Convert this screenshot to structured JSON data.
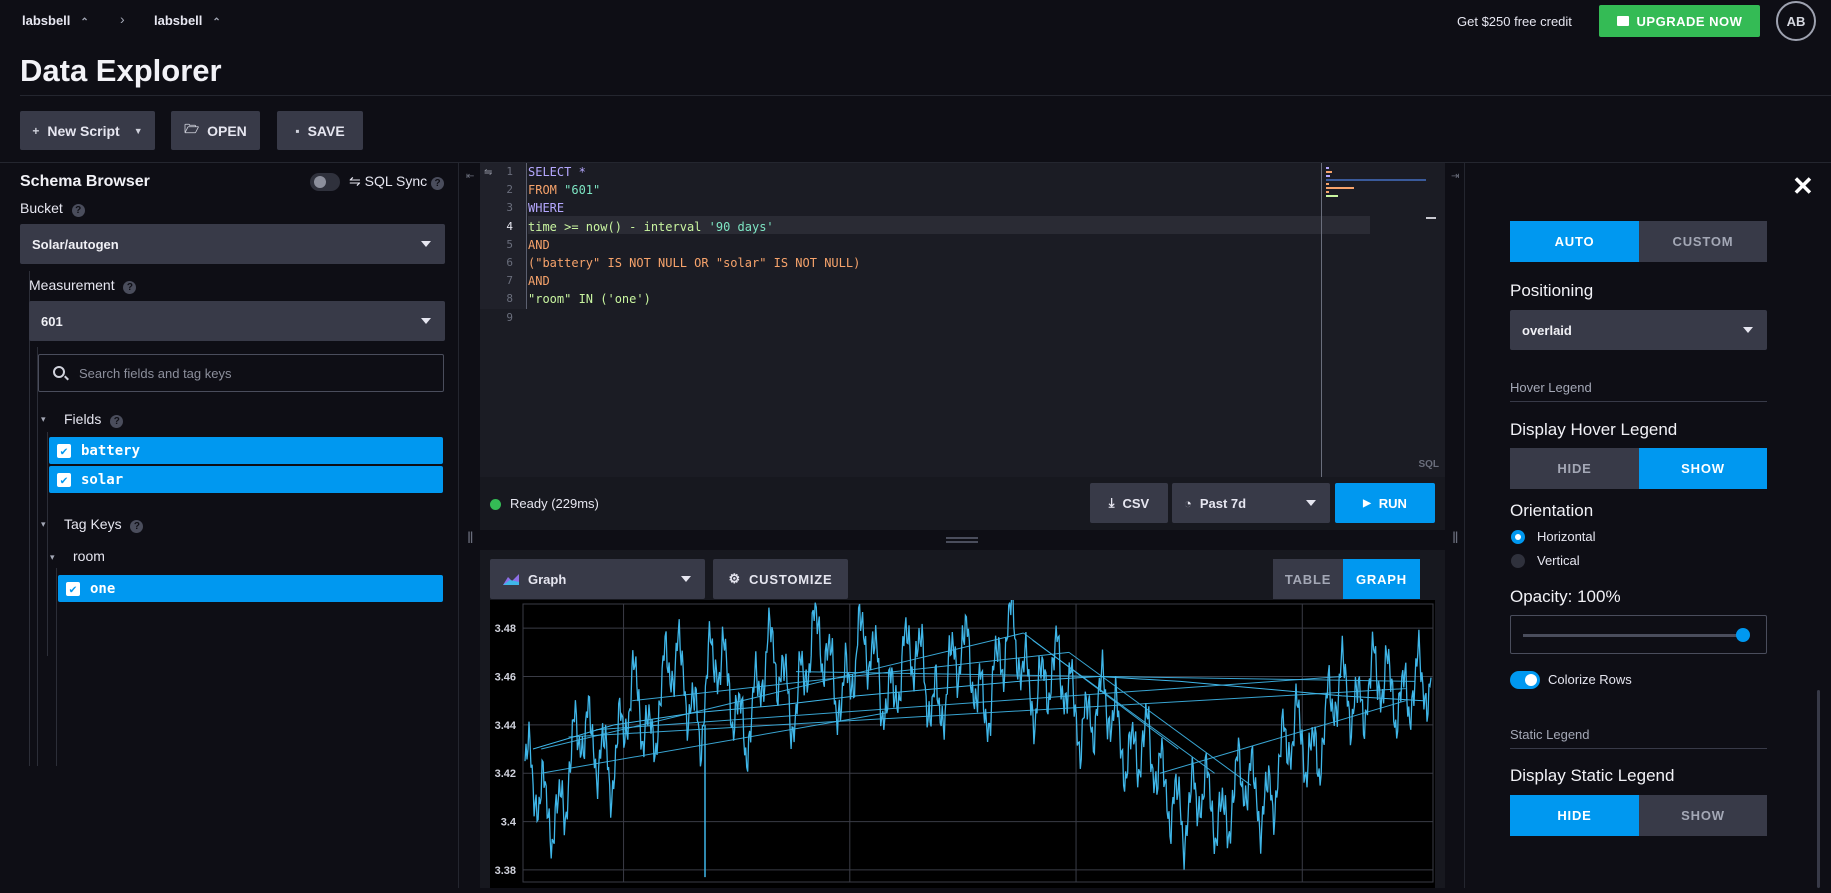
{
  "breadcrumb": {
    "org": "labsbell",
    "bucket": "labsbell"
  },
  "header": {
    "credit_text": "Get $250 free credit",
    "upgrade_label": "UPGRADE NOW",
    "avatar_initials": "AB"
  },
  "page_title": "Data Explorer",
  "toolbar": {
    "new_script": "New Script",
    "open": "OPEN",
    "save": "SAVE"
  },
  "schema": {
    "title": "Schema Browser",
    "sql_sync": "SQL Sync",
    "bucket_label": "Bucket",
    "bucket_value": "Solar/autogen",
    "measurement_label": "Measurement",
    "measurement_value": "601",
    "search_placeholder": "Search fields and tag keys",
    "fields_label": "Fields",
    "fields": [
      "battery",
      "solar"
    ],
    "tag_keys_label": "Tag Keys",
    "tag_key": "room",
    "tag_values": [
      "one"
    ]
  },
  "editor": {
    "line_numbers": [
      "1",
      "2",
      "3",
      "4",
      "5",
      "6",
      "7",
      "8",
      "9"
    ],
    "lines": [
      [
        {
          "t": "SELECT *",
          "c": "#b5a8ff"
        }
      ],
      [
        {
          "t": "FROM ",
          "c": "#f7a36b"
        },
        {
          "t": "\"601\"",
          "c": "#7ee6c4"
        }
      ],
      [
        {
          "t": "WHERE",
          "c": "#b5a8ff"
        }
      ],
      [
        {
          "t": "time >= now() - interval ",
          "c": "#c9f5a0"
        },
        {
          "t": "'90 days'",
          "c": "#7ee6c4"
        }
      ],
      [
        {
          "t": "AND",
          "c": "#f7a36b"
        }
      ],
      [
        {
          "t": "(\"battery\" IS NOT NULL OR \"solar\" IS NOT NULL)",
          "c": "#f7a36b"
        }
      ],
      [
        {
          "t": "AND",
          "c": "#f7a36b"
        }
      ],
      [
        {
          "t": "\"room\" IN ('one')",
          "c": "#c9f5a0"
        }
      ],
      [
        {
          "t": "",
          "c": "#e6e6f0"
        }
      ]
    ],
    "language": "SQL"
  },
  "status": {
    "text": "Ready (229ms)",
    "csv": "CSV",
    "time_range": "Past 7d",
    "run": "RUN"
  },
  "viz": {
    "type": "Graph",
    "customize": "CUSTOMIZE",
    "table_tab": "TABLE",
    "graph_tab": "GRAPH"
  },
  "chart_data": {
    "type": "line",
    "title": "",
    "xlabel": "",
    "ylabel": "",
    "ylim": [
      3.375,
      3.49
    ],
    "y_ticks": [
      "3.48",
      "3.46",
      "3.44",
      "3.42",
      "3.4",
      "3.38"
    ],
    "y_tick_values": [
      3.48,
      3.46,
      3.44,
      3.42,
      3.4,
      3.38
    ],
    "grid": true,
    "color": "#3fb6e8",
    "series": [
      {
        "values": [
          3.425,
          3.418,
          3.41,
          3.404,
          3.399,
          3.41,
          3.43,
          3.44,
          3.436,
          3.43,
          3.425,
          3.42,
          3.435,
          3.45,
          3.456,
          3.44,
          3.43,
          3.452,
          3.466,
          3.468,
          3.46,
          3.445,
          3.437,
          3.462,
          3.47,
          3.464,
          3.452,
          3.44,
          3.436,
          3.45,
          3.466,
          3.472,
          3.465,
          3.45,
          3.445,
          3.46,
          3.475,
          3.478,
          3.468,
          3.455,
          3.45,
          3.462,
          3.474,
          3.476,
          3.466,
          3.452,
          3.448,
          3.46,
          3.47,
          3.473,
          3.464,
          3.45,
          3.445,
          3.455,
          3.468,
          3.473,
          3.468,
          3.452,
          3.444,
          3.458,
          3.47,
          3.482,
          3.474,
          3.458,
          3.45,
          3.455,
          3.462,
          3.466,
          3.458,
          3.448,
          3.438,
          3.44,
          3.45,
          3.452,
          3.445,
          3.432,
          3.425,
          3.43,
          3.435,
          3.428,
          3.418,
          3.41,
          3.405,
          3.4,
          3.408,
          3.415,
          3.41,
          3.402,
          3.398,
          3.41,
          3.42,
          3.418,
          3.41,
          3.405,
          3.41,
          3.425,
          3.435,
          3.44,
          3.432,
          3.425,
          3.43,
          3.445,
          3.455,
          3.458,
          3.45,
          3.445,
          3.455,
          3.462,
          3.46,
          3.455,
          3.448,
          3.452,
          3.458,
          3.46,
          3.455
        ]
      },
      {
        "values": [
          3.43,
          3.44,
          3.445,
          3.448,
          3.452,
          3.455,
          3.458,
          3.46,
          3.458,
          3.455,
          3.452,
          3.45
        ]
      }
    ]
  },
  "customize_panel": {
    "auto": "AUTO",
    "custom": "CUSTOM",
    "positioning_label": "Positioning",
    "positioning_value": "overlaid",
    "hover_legend_section": "Hover Legend",
    "display_hover_legend": "Display Hover Legend",
    "hide": "HIDE",
    "show": "SHOW",
    "orientation_label": "Orientation",
    "orientation_horizontal": "Horizontal",
    "orientation_vertical": "Vertical",
    "opacity_label": "Opacity: 100%",
    "opacity": 1.0,
    "colorize_rows": "Colorize Rows",
    "static_legend_section": "Static Legend",
    "display_static_legend": "Display Static Legend"
  }
}
